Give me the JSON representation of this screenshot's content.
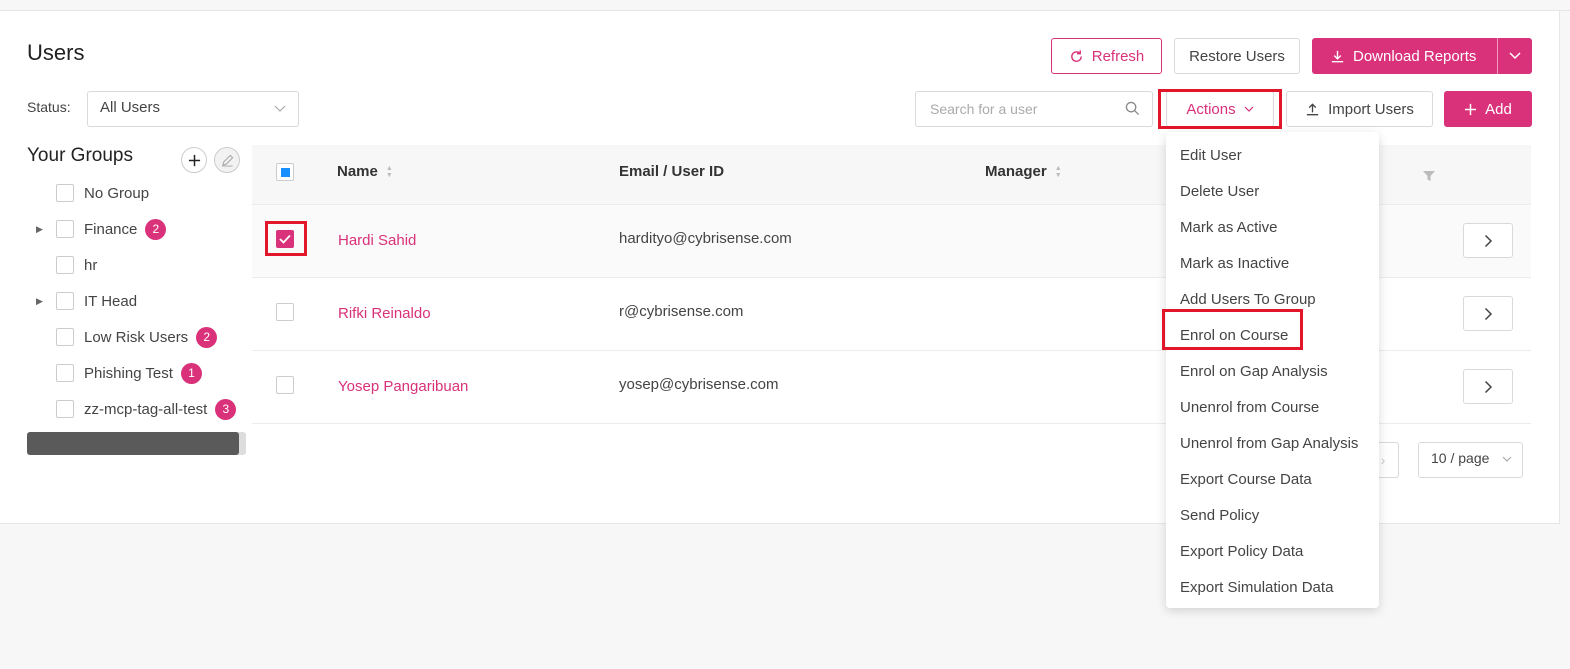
{
  "page": {
    "title": "Users"
  },
  "toolbar": {
    "refresh_label": "Refresh",
    "restore_label": "Restore Users",
    "download_label": "Download Reports",
    "import_label": "Import Users",
    "add_label": "Add",
    "actions_label": "Actions"
  },
  "filter": {
    "status_label": "Status:",
    "status_value": "All Users",
    "search_placeholder": "Search for a user"
  },
  "groups": {
    "title": "Your Groups",
    "items": [
      {
        "label": "No Group",
        "count": "",
        "expandable": false
      },
      {
        "label": "Finance",
        "count": "2",
        "expandable": true
      },
      {
        "label": "hr",
        "count": "",
        "expandable": false
      },
      {
        "label": "IT Head",
        "count": "",
        "expandable": true
      },
      {
        "label": "Low Risk Users",
        "count": "2",
        "expandable": false
      },
      {
        "label": "Phishing Test",
        "count": "1",
        "expandable": false
      },
      {
        "label": "zz-mcp-tag-all-test",
        "count": "3",
        "expandable": false
      }
    ]
  },
  "table": {
    "columns": {
      "name": "Name",
      "email": "Email / User ID",
      "manager": "Manager"
    },
    "rows": [
      {
        "name": "Hardi Sahid",
        "email": "hardityo@cybrisense.com",
        "checked": true
      },
      {
        "name": "Rifki Reinaldo",
        "email": "r@cybrisense.com",
        "checked": false
      },
      {
        "name": "Yosep Pangaribuan",
        "email": "yosep@cybrisense.com",
        "checked": false
      }
    ]
  },
  "pagination": {
    "page_size": "10 / page"
  },
  "actions_menu": {
    "items": [
      "Edit User",
      "Delete User",
      "Mark as Active",
      "Mark as Inactive",
      "Add Users To Group",
      "Enrol on Course",
      "Enrol on Gap Analysis",
      "Unenrol from Course",
      "Unenrol from Gap Analysis",
      "Export Course Data",
      "Send Policy",
      "Export Policy Data",
      "Export Simulation Data"
    ]
  },
  "colors": {
    "brand": "#d9317a",
    "highlight": "#e2162b",
    "indeterminate": "#1890ff"
  },
  "icons": [
    "refresh-icon",
    "download-icon",
    "chevron-down-icon",
    "search-icon",
    "upload-icon",
    "plus-icon",
    "edit-icon",
    "caret-right-icon",
    "sort-icon",
    "filter-icon",
    "arrow-right-icon",
    "check-icon"
  ]
}
